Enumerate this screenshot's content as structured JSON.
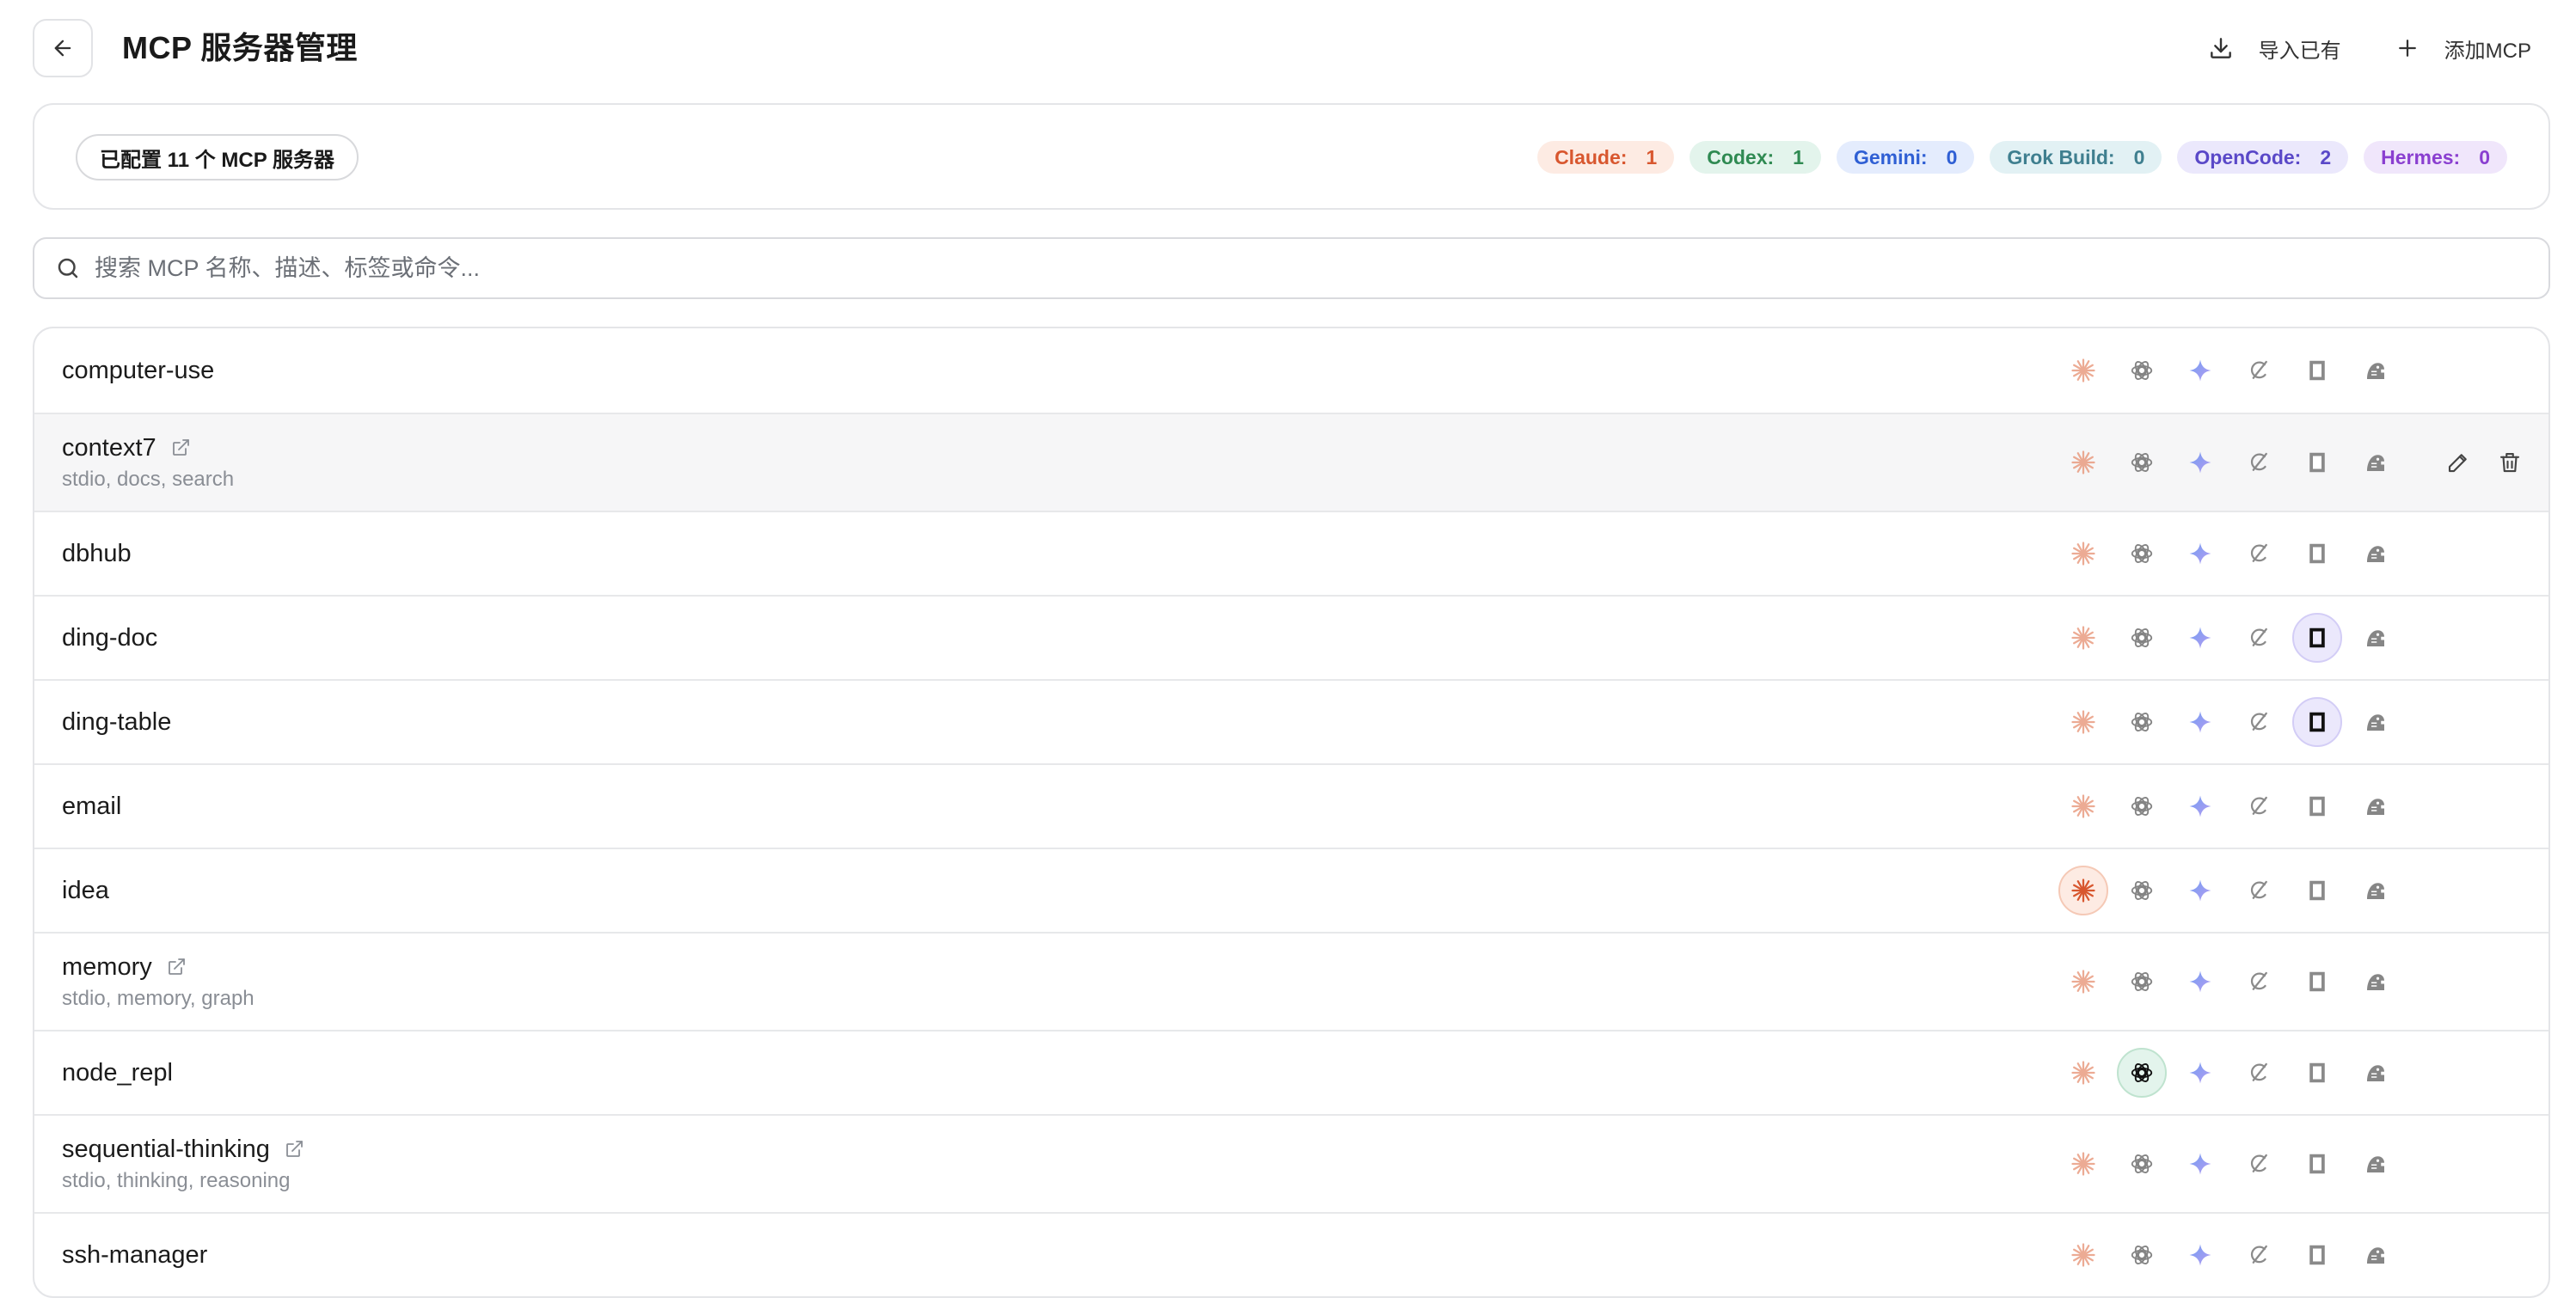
{
  "header": {
    "title": "MCP 服务器管理",
    "import_label": "导入已有",
    "add_label": "添加MCP"
  },
  "summary": {
    "count_label": "已配置 11 个 MCP 服务器",
    "badges": [
      {
        "label": "Claude:",
        "value": "1",
        "bg": "#fdebe3",
        "fg": "#d8572f"
      },
      {
        "label": "Codex:",
        "value": "1",
        "bg": "#e3f4ec",
        "fg": "#2f8a52"
      },
      {
        "label": "Gemini:",
        "value": "0",
        "bg": "#e4ecfd",
        "fg": "#2f5fd4"
      },
      {
        "label": "Grok Build:",
        "value": "0",
        "bg": "#e2f1f4",
        "fg": "#3f7f8f"
      },
      {
        "label": "OpenCode:",
        "value": "2",
        "bg": "#ebe8fc",
        "fg": "#5a48c8"
      },
      {
        "label": "Hermes:",
        "value": "0",
        "bg": "#f0e6fb",
        "fg": "#8a3fd0"
      }
    ]
  },
  "search": {
    "placeholder": "搜索 MCP 名称、描述、标签或命令..."
  },
  "apps": [
    "claude-icon",
    "codex-icon",
    "gemini-icon",
    "grok-icon",
    "opencode-icon",
    "hermes-icon"
  ],
  "servers": [
    {
      "name": "computer-use",
      "tags": "",
      "external": false,
      "enabled": []
    },
    {
      "name": "context7",
      "tags": "stdio, docs, search",
      "external": true,
      "enabled": [],
      "hover": true
    },
    {
      "name": "dbhub",
      "tags": "",
      "external": false,
      "enabled": []
    },
    {
      "name": "ding-doc",
      "tags": "",
      "external": false,
      "enabled": [
        "opencode"
      ]
    },
    {
      "name": "ding-table",
      "tags": "",
      "external": false,
      "enabled": [
        "opencode"
      ]
    },
    {
      "name": "email",
      "tags": "",
      "external": false,
      "enabled": []
    },
    {
      "name": "idea",
      "tags": "",
      "external": false,
      "enabled": [
        "claude"
      ]
    },
    {
      "name": "memory",
      "tags": "stdio, memory, graph",
      "external": true,
      "enabled": []
    },
    {
      "name": "node_repl",
      "tags": "",
      "external": false,
      "enabled": [
        "codex"
      ]
    },
    {
      "name": "sequential-thinking",
      "tags": "stdio, thinking, reasoning",
      "external": true,
      "enabled": []
    },
    {
      "name": "ssh-manager",
      "tags": "",
      "external": false,
      "enabled": []
    }
  ]
}
